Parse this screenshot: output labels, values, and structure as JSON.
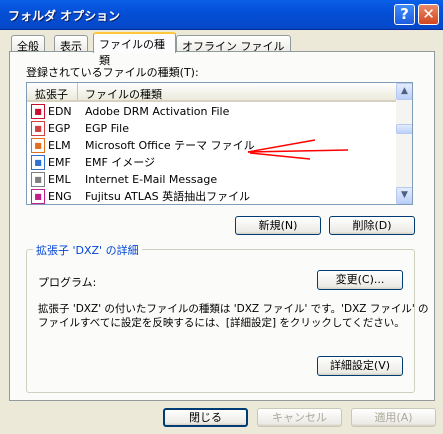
{
  "window": {
    "title": "フォルダ オプション",
    "help_label": "?",
    "close_label": "✕"
  },
  "tabs": [
    {
      "label": "全般"
    },
    {
      "label": "表示"
    },
    {
      "label": "ファイルの種類",
      "active": true
    },
    {
      "label": "オフライン ファイル"
    }
  ],
  "filetypes": {
    "label": "登録されているファイルの種類(T):",
    "columns": [
      "拡張子",
      "ファイルの種類"
    ],
    "rows": [
      {
        "ext": "EDN",
        "desc": "Adobe DRM Activation File",
        "icon": "adobe-file-icon",
        "color": "#C8102E"
      },
      {
        "ext": "EGP",
        "desc": "EGP File",
        "icon": "egp-file-icon",
        "color": "#D04040"
      },
      {
        "ext": "ELM",
        "desc": "Microsoft Office テーマ ファイル",
        "icon": "office-theme-icon",
        "color": "#E07020"
      },
      {
        "ext": "EMF",
        "desc": "EMF イメージ",
        "icon": "image-file-icon",
        "color": "#3070D0"
      },
      {
        "ext": "EML",
        "desc": "Internet E-Mail Message",
        "icon": "mail-icon",
        "color": "#808080"
      },
      {
        "ext": "ENG",
        "desc": "Fujitsu ATLAS 英語抽出ファイル",
        "icon": "atlas-file-icon",
        "color": "#C0208A"
      }
    ],
    "new_button": "新規(N)",
    "delete_button": "削除(D)"
  },
  "details": {
    "legend": "拡張子 'DXZ' の詳細",
    "program_label": "プログラム:",
    "change_button": "変更(C)...",
    "line1": "拡張子 'DXZ' の付いたファイルの種類は 'DXZ ファイル' です。'DXZ ファイル' の",
    "line2": "ファイルすべてに設定を反映するには、[詳細設定] をクリックしてください。",
    "advanced_button": "詳細設定(V)"
  },
  "footer": {
    "close": "閉じる",
    "cancel": "キャンセル",
    "apply": "適用(A)"
  },
  "annotation": {
    "color": "#FF0000",
    "icon": "red-arrow"
  }
}
